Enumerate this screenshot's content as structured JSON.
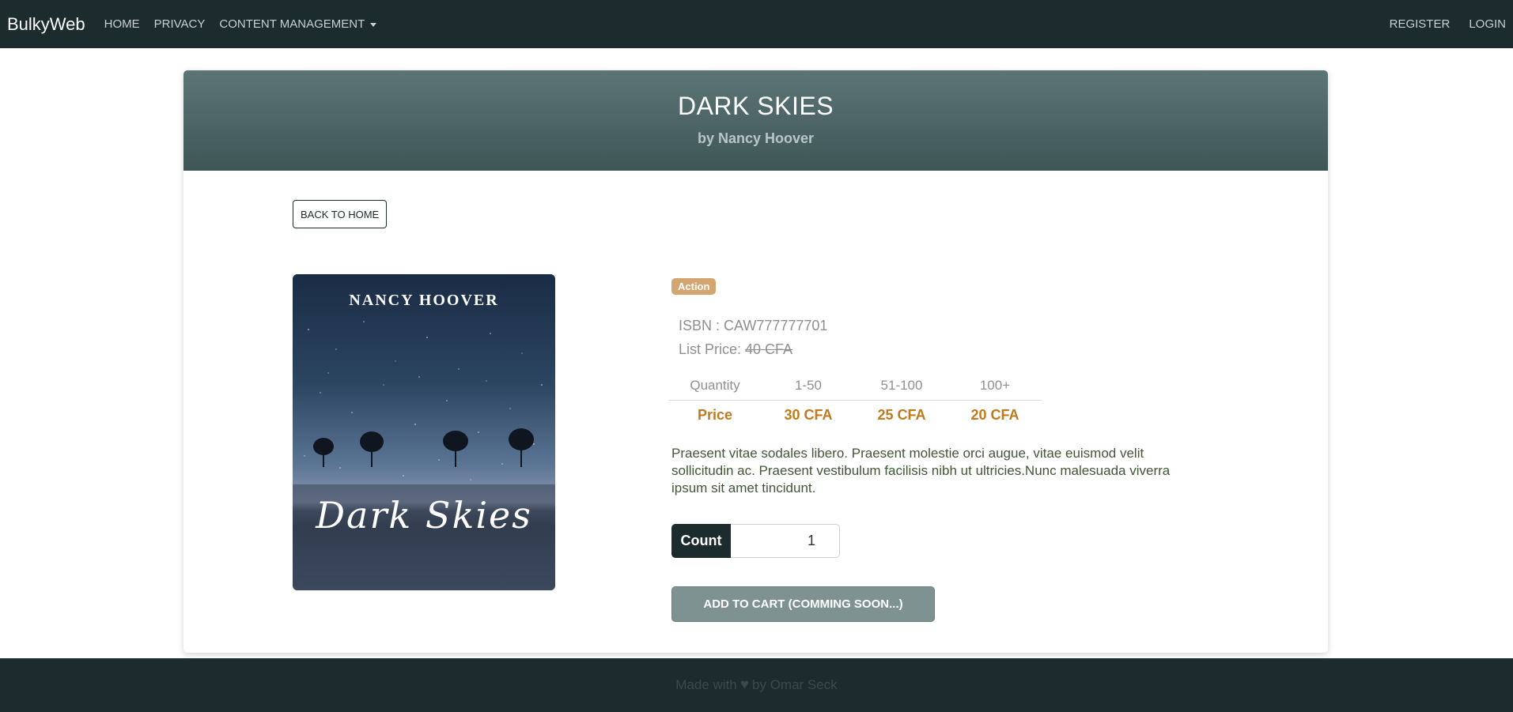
{
  "navbar": {
    "brand": "BulkyWeb",
    "links": [
      "HOME",
      "PRIVACY",
      "CONTENT MANAGEMENT"
    ],
    "right_links": [
      "REGISTER",
      "LOGIN"
    ]
  },
  "product": {
    "title": "DARK SKIES",
    "author": "by Nancy Hoover",
    "back_label": "BACK TO HOME",
    "cover_author": "NANCY HOOVER",
    "cover_title": "Dark Skies",
    "category": "Action",
    "isbn_label": "ISBN : CAW777777701",
    "list_price_label": "List Price: ",
    "list_price_value": "40 CFA",
    "price_table": {
      "header": [
        "Quantity",
        "1-50",
        "51-100",
        "100+"
      ],
      "values": [
        "Price",
        "30 CFA",
        "25 CFA",
        "20 CFA"
      ]
    },
    "description": "Praesent vitae sodales libero. Praesent molestie orci augue, vitae euismod velit sollicitudin ac. Praesent vestibulum facilisis nibh ut ultricies.Nunc malesuada viverra ipsum sit amet tincidunt.",
    "count_label": "Count",
    "count_value": "1",
    "add_to_cart_label": "ADD TO CART (COMMING SOON...)"
  },
  "footer": {
    "text_before": "Made with",
    "icon": "heart-icon",
    "text_after": "by Omar Seck"
  },
  "colors": {
    "navbar": "#1c2b2d",
    "header_gradient_top": "#5c7576",
    "header_gradient_bottom": "#3f5657",
    "badge": "#d2a571",
    "price": "#c07a1d",
    "button": "#7f9292"
  }
}
